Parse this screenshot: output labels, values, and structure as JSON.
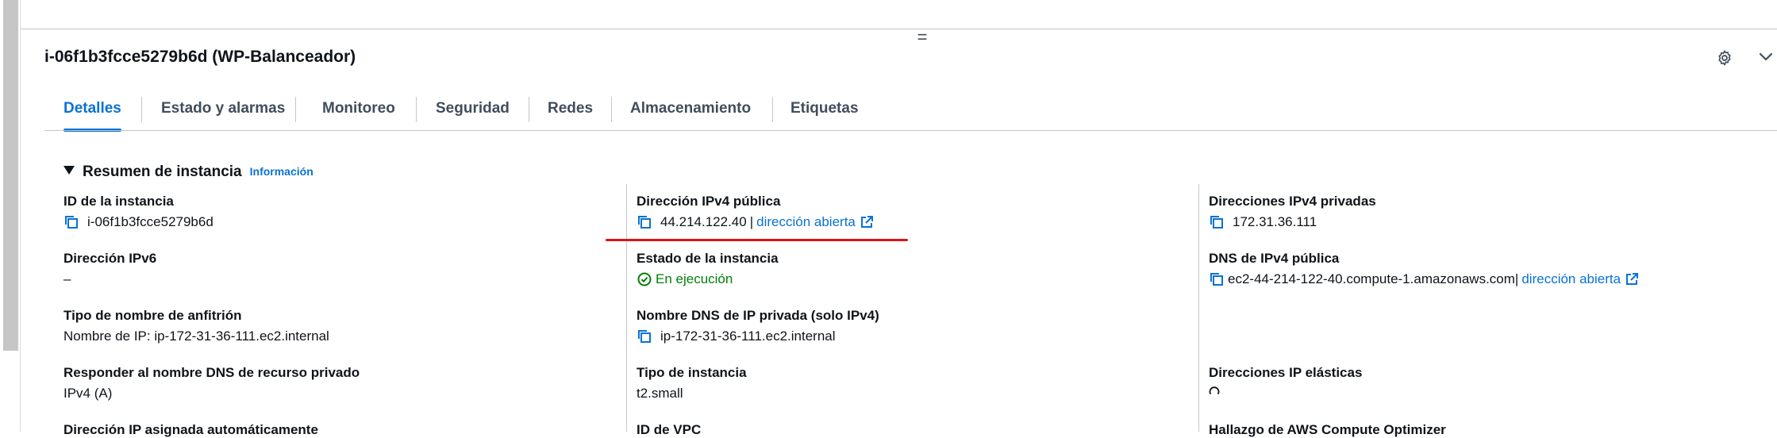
{
  "panel": {
    "title": "i-06f1b3fcce5279b6d (WP-Balanceador)"
  },
  "tabs": [
    "Detalles",
    "Estado y alarmas",
    "Monitoreo",
    "Seguridad",
    "Redes",
    "Almacenamiento",
    "Etiquetas"
  ],
  "section": {
    "title": "Resumen de instancia",
    "info_link": "Información"
  },
  "fields": {
    "instance_id": {
      "label": "ID de la instancia",
      "value": "i-06f1b3fcce5279b6d"
    },
    "public_ipv4": {
      "label": "Dirección IPv4 pública",
      "value": "44.214.122.40",
      "link": "dirección abierta"
    },
    "private_ipv4": {
      "label": "Direcciones IPv4 privadas",
      "value": "172.31.36.111"
    },
    "ipv6": {
      "label": "Dirección IPv6",
      "value": "–"
    },
    "instance_state": {
      "label": "Estado de la instancia",
      "value": "En ejecución"
    },
    "public_dns": {
      "label": "DNS de IPv4 pública",
      "value": "ec2-44-214-122-40.compute-1.amazonaws.com",
      "link": "dirección abierta"
    },
    "hostname_type": {
      "label": "Tipo de nombre de anfitrión",
      "value": "Nombre de IP: ip-172-31-36-111.ec2.internal"
    },
    "private_dns": {
      "label": "Nombre DNS de IP privada (solo IPv4)",
      "value": "ip-172-31-36-111.ec2.internal"
    },
    "resource_dns": {
      "label": "Responder al nombre DNS de recurso privado",
      "value": "IPv4 (A)"
    },
    "instance_type": {
      "label": "Tipo de instancia",
      "value": "t2.small"
    },
    "elastic_ip": {
      "label": "Direcciones IP elásticas"
    },
    "auto_ip": {
      "label": "Dirección IP asignada automáticamente"
    },
    "vpc_id": {
      "label": "ID de VPC"
    },
    "optimizer": {
      "label": "Hallazgo de AWS Compute Optimizer"
    }
  },
  "colors": {
    "link": "#0972d3",
    "success": "#037f0c",
    "annotation": "#d91515"
  }
}
